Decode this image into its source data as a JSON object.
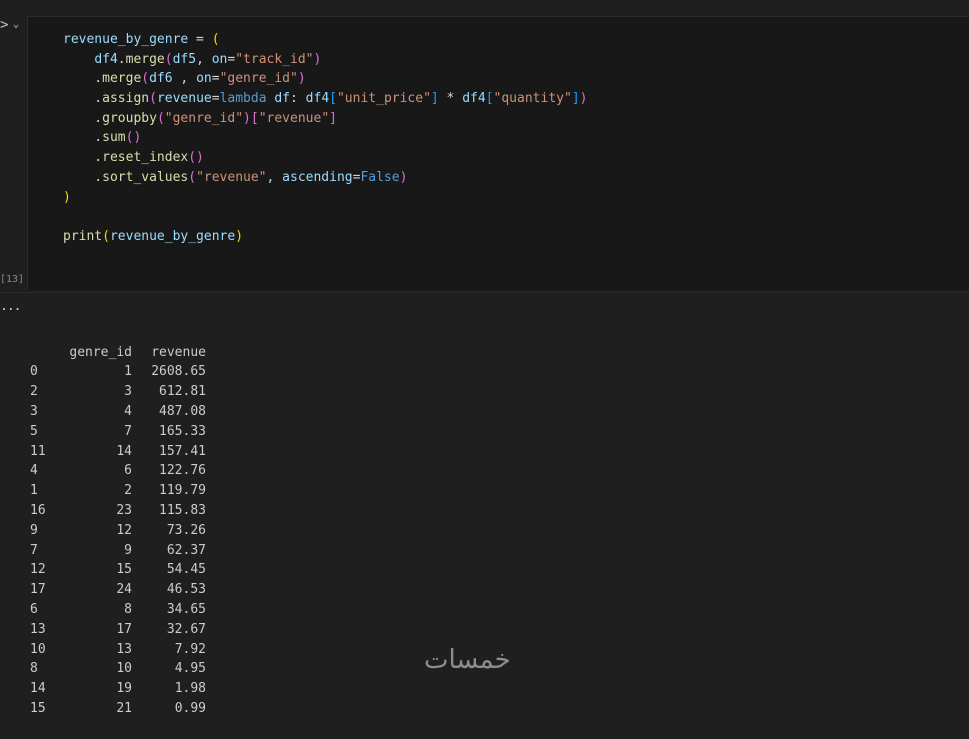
{
  "cell": {
    "execution_count": "[13]",
    "run_icon": "run-icon",
    "collapse_icon": "chevron-down-icon"
  },
  "output": {
    "more_label": "...",
    "headers": [
      "",
      "genre_id",
      "revenue"
    ],
    "rows": [
      [
        "0",
        "1",
        "2608.65"
      ],
      [
        "2",
        "3",
        "612.81"
      ],
      [
        "3",
        "4",
        "487.08"
      ],
      [
        "5",
        "7",
        "165.33"
      ],
      [
        "11",
        "14",
        "157.41"
      ],
      [
        "4",
        "6",
        "122.76"
      ],
      [
        "1",
        "2",
        "119.79"
      ],
      [
        "16",
        "23",
        "115.83"
      ],
      [
        "9",
        "12",
        "73.26"
      ],
      [
        "7",
        "9",
        "62.37"
      ],
      [
        "12",
        "15",
        "54.45"
      ],
      [
        "17",
        "24",
        "46.53"
      ],
      [
        "6",
        "8",
        "34.65"
      ],
      [
        "13",
        "17",
        "32.67"
      ],
      [
        "10",
        "13",
        "7.92"
      ],
      [
        "8",
        "10",
        "4.95"
      ],
      [
        "14",
        "19",
        "1.98"
      ],
      [
        "15",
        "21",
        "0.99"
      ]
    ]
  },
  "watermark": "خمسات",
  "code_lines": [
    [
      [
        "var",
        "revenue_by_genre"
      ],
      [
        "op",
        " = "
      ],
      [
        "p1",
        "("
      ]
    ],
    [
      [
        "op",
        "    "
      ],
      [
        "var",
        "df4"
      ],
      [
        "op",
        "."
      ],
      [
        "fn",
        "merge"
      ],
      [
        "p2",
        "("
      ],
      [
        "var",
        "df5"
      ],
      [
        "op",
        ", "
      ],
      [
        "var",
        "on"
      ],
      [
        "op",
        "="
      ],
      [
        "str",
        "\"track_id\""
      ],
      [
        "p2",
        ")"
      ]
    ],
    [
      [
        "op",
        "    ."
      ],
      [
        "fn",
        "merge"
      ],
      [
        "p2",
        "("
      ],
      [
        "var",
        "df6"
      ],
      [
        "op",
        " , "
      ],
      [
        "var",
        "on"
      ],
      [
        "op",
        "="
      ],
      [
        "str",
        "\"genre_id\""
      ],
      [
        "p2",
        ")"
      ]
    ],
    [
      [
        "op",
        "    ."
      ],
      [
        "fn",
        "assign"
      ],
      [
        "p2",
        "("
      ],
      [
        "var",
        "revenue"
      ],
      [
        "op",
        "="
      ],
      [
        "kw",
        "lambda"
      ],
      [
        "op",
        " "
      ],
      [
        "var",
        "df"
      ],
      [
        "op",
        ": "
      ],
      [
        "var",
        "df4"
      ],
      [
        "p3",
        "["
      ],
      [
        "str",
        "\"unit_price\""
      ],
      [
        "p3",
        "]"
      ],
      [
        "op",
        " * "
      ],
      [
        "var",
        "df4"
      ],
      [
        "p3",
        "["
      ],
      [
        "str",
        "\"quantity\""
      ],
      [
        "p3",
        "]"
      ],
      [
        "p2",
        ")"
      ]
    ],
    [
      [
        "op",
        "    ."
      ],
      [
        "fn",
        "groupby"
      ],
      [
        "p2",
        "("
      ],
      [
        "str",
        "\"genre_id\""
      ],
      [
        "p2",
        ")"
      ],
      [
        "p2",
        "["
      ],
      [
        "str",
        "\"revenue\""
      ],
      [
        "p2",
        "]"
      ]
    ],
    [
      [
        "op",
        "    ."
      ],
      [
        "fn",
        "sum"
      ],
      [
        "p2",
        "()"
      ]
    ],
    [
      [
        "op",
        "    ."
      ],
      [
        "fn",
        "reset_index"
      ],
      [
        "p2",
        "()"
      ]
    ],
    [
      [
        "op",
        "    ."
      ],
      [
        "fn",
        "sort_values"
      ],
      [
        "p2",
        "("
      ],
      [
        "str",
        "\"revenue\""
      ],
      [
        "op",
        ", "
      ],
      [
        "var",
        "ascending"
      ],
      [
        "op",
        "="
      ],
      [
        "kw",
        "False"
      ],
      [
        "p2",
        ")"
      ]
    ],
    [
      [
        "p1",
        ")"
      ]
    ],
    [
      [
        "op",
        ""
      ]
    ],
    [
      [
        "fn",
        "print"
      ],
      [
        "p1",
        "("
      ],
      [
        "var",
        "revenue_by_genre"
      ],
      [
        "p1",
        ")"
      ]
    ]
  ]
}
